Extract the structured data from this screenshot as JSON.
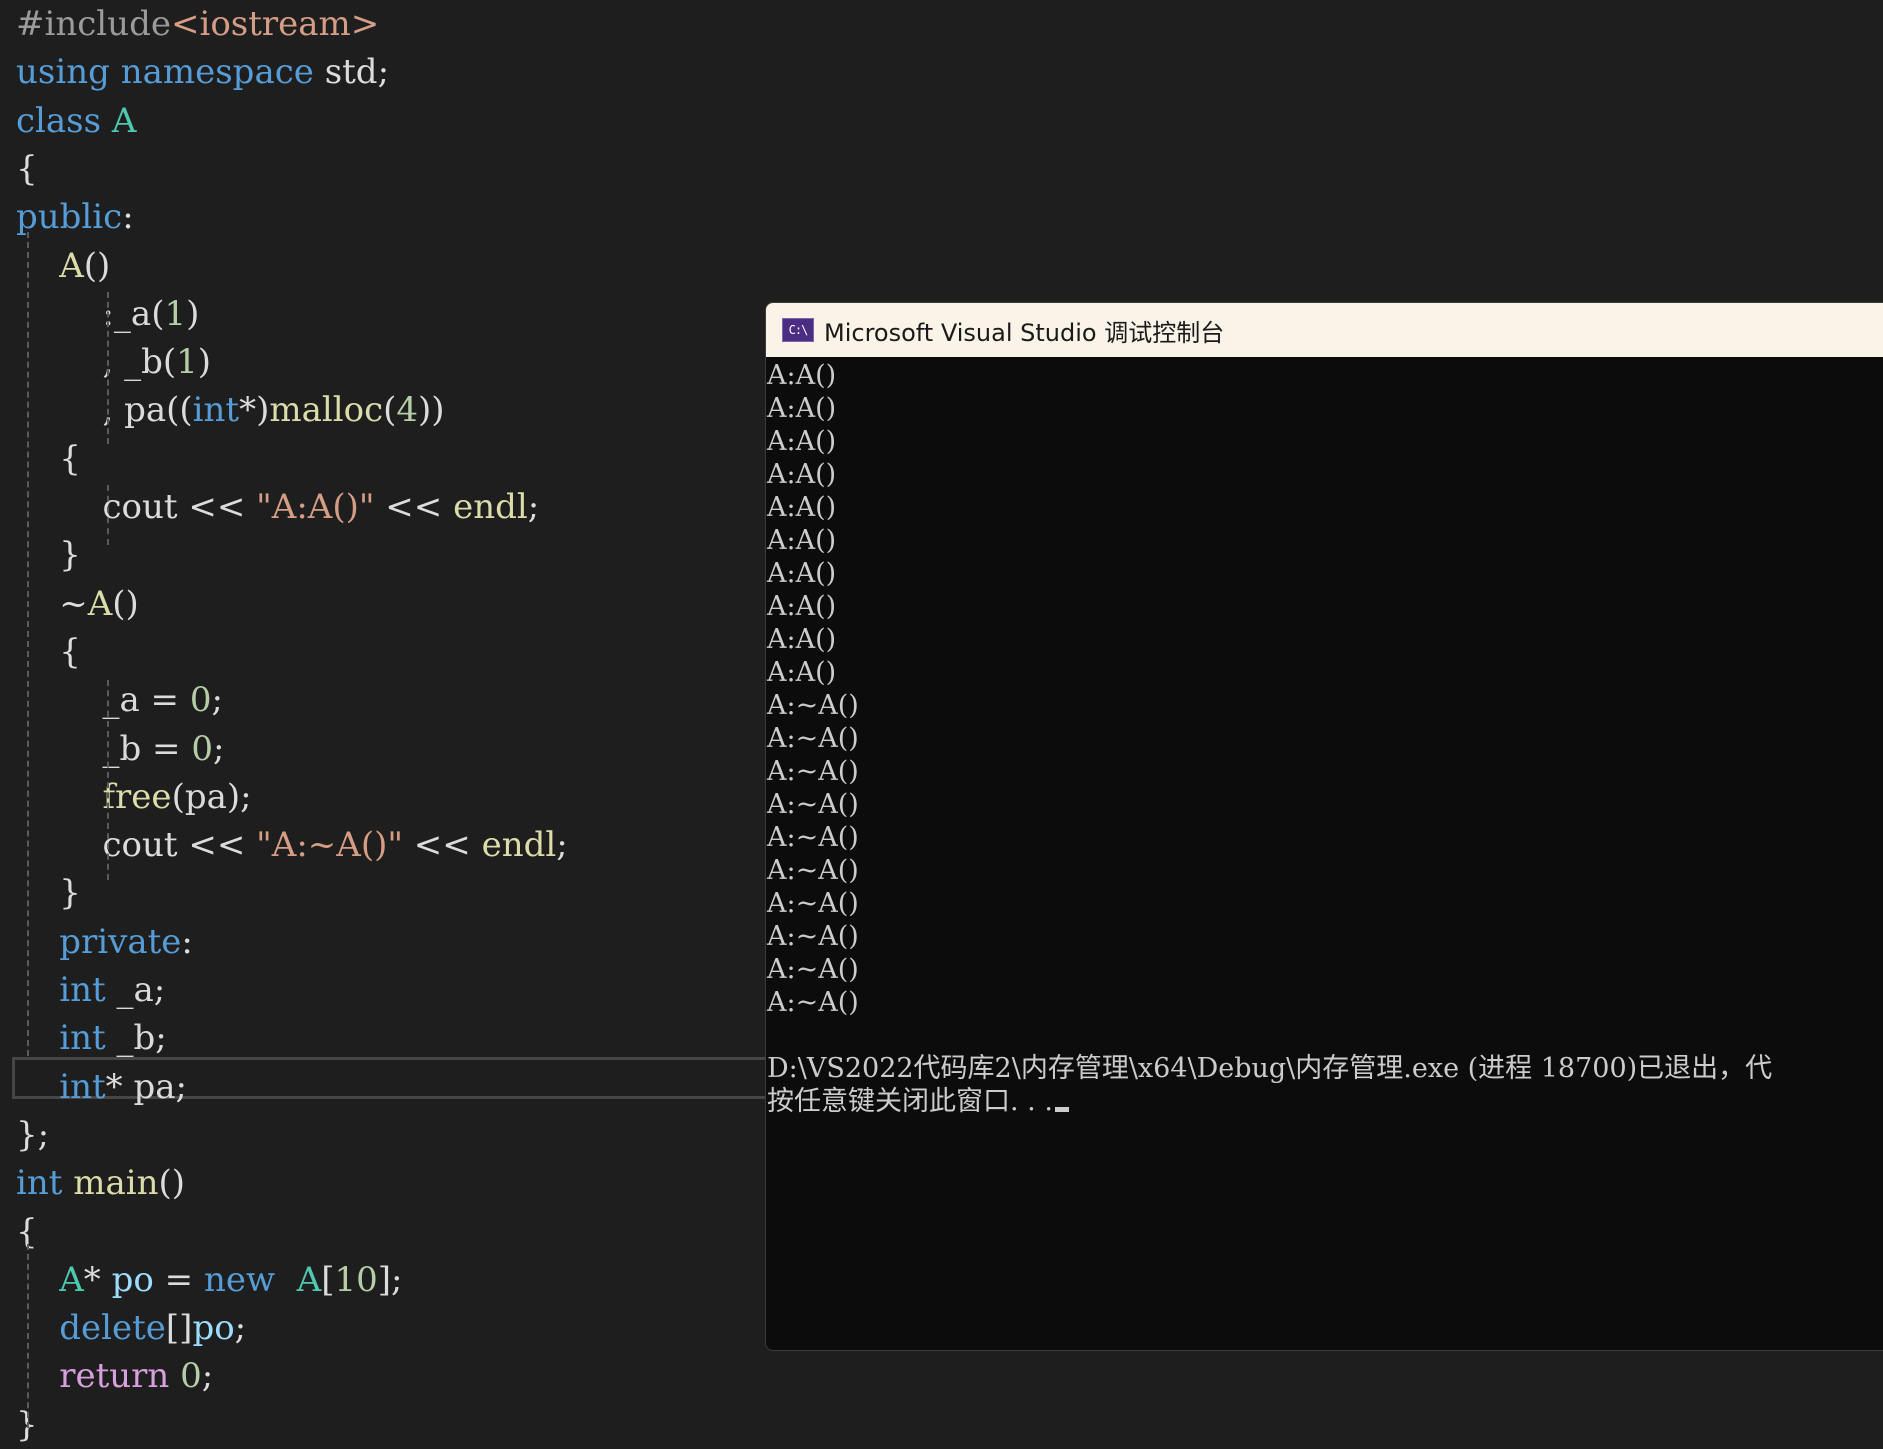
{
  "colors": {
    "editor_background": "#1e1e1e",
    "keyword": "#569cd6",
    "type_name": "#4ec9b0",
    "function": "#dcdcaa",
    "control_keyword": "#d8a0df",
    "preprocessor": "#9b9b9b",
    "string": "#d69d85",
    "number": "#b5cea8",
    "variable": "#9cdcfe",
    "field": "#dadada",
    "plain": "#dcdcdc",
    "console_background": "#0c0c0c",
    "console_text": "#cccccc",
    "console_titlebar": "#f9f3e8"
  },
  "code": [
    {
      "tokens": [
        {
          "text": "#include",
          "kind": "preprocessor"
        },
        {
          "text": "<iostream>",
          "kind": "string"
        }
      ]
    },
    {
      "tokens": [
        {
          "text": "using",
          "kind": "keyword"
        },
        {
          "text": " ",
          "kind": "plain"
        },
        {
          "text": "namespace",
          "kind": "keyword"
        },
        {
          "text": " std;",
          "kind": "plain"
        }
      ]
    },
    {
      "tokens": [
        {
          "text": "class",
          "kind": "keyword"
        },
        {
          "text": " ",
          "kind": "plain"
        },
        {
          "text": "A",
          "kind": "type_name"
        }
      ]
    },
    {
      "tokens": [
        {
          "text": "{",
          "kind": "plain"
        }
      ]
    },
    {
      "tokens": [
        {
          "text": "public",
          "kind": "keyword"
        },
        {
          "text": ":",
          "kind": "plain"
        }
      ]
    },
    {
      "tokens": [
        {
          "text": "    ",
          "kind": "plain"
        },
        {
          "text": "A",
          "kind": "function"
        },
        {
          "text": "()",
          "kind": "plain"
        }
      ]
    },
    {
      "tokens": [
        {
          "text": "        :",
          "kind": "plain"
        },
        {
          "text": "_a",
          "kind": "field"
        },
        {
          "text": "(",
          "kind": "plain"
        },
        {
          "text": "1",
          "kind": "number"
        },
        {
          "text": ")",
          "kind": "plain"
        }
      ]
    },
    {
      "tokens": [
        {
          "text": "        , ",
          "kind": "plain"
        },
        {
          "text": "_b",
          "kind": "field"
        },
        {
          "text": "(",
          "kind": "plain"
        },
        {
          "text": "1",
          "kind": "number"
        },
        {
          "text": ")",
          "kind": "plain"
        }
      ]
    },
    {
      "tokens": [
        {
          "text": "        , ",
          "kind": "plain"
        },
        {
          "text": "pa",
          "kind": "field"
        },
        {
          "text": "((",
          "kind": "plain"
        },
        {
          "text": "int",
          "kind": "keyword"
        },
        {
          "text": "*)",
          "kind": "plain"
        },
        {
          "text": "malloc",
          "kind": "function"
        },
        {
          "text": "(",
          "kind": "plain"
        },
        {
          "text": "4",
          "kind": "number"
        },
        {
          "text": "))",
          "kind": "plain"
        }
      ]
    },
    {
      "tokens": [
        {
          "text": "    {",
          "kind": "plain"
        }
      ]
    },
    {
      "tokens": [
        {
          "text": "        cout << ",
          "kind": "plain"
        },
        {
          "text": "\"A:A()\"",
          "kind": "string"
        },
        {
          "text": " << ",
          "kind": "plain"
        },
        {
          "text": "endl",
          "kind": "function"
        },
        {
          "text": ";",
          "kind": "plain"
        }
      ]
    },
    {
      "tokens": [
        {
          "text": "    }",
          "kind": "plain"
        }
      ]
    },
    {
      "tokens": [
        {
          "text": "    ~",
          "kind": "plain"
        },
        {
          "text": "A",
          "kind": "function"
        },
        {
          "text": "()",
          "kind": "plain"
        }
      ]
    },
    {
      "tokens": [
        {
          "text": "    {",
          "kind": "plain"
        }
      ]
    },
    {
      "tokens": [
        {
          "text": "        ",
          "kind": "plain"
        },
        {
          "text": "_a",
          "kind": "field"
        },
        {
          "text": " = ",
          "kind": "plain"
        },
        {
          "text": "0",
          "kind": "number"
        },
        {
          "text": ";",
          "kind": "plain"
        }
      ]
    },
    {
      "tokens": [
        {
          "text": "        ",
          "kind": "plain"
        },
        {
          "text": "_b",
          "kind": "field"
        },
        {
          "text": " = ",
          "kind": "plain"
        },
        {
          "text": "0",
          "kind": "number"
        },
        {
          "text": ";",
          "kind": "plain"
        }
      ]
    },
    {
      "tokens": [
        {
          "text": "        ",
          "kind": "plain"
        },
        {
          "text": "free",
          "kind": "function"
        },
        {
          "text": "(",
          "kind": "plain"
        },
        {
          "text": "pa",
          "kind": "field"
        },
        {
          "text": ");",
          "kind": "plain"
        }
      ]
    },
    {
      "tokens": [
        {
          "text": "        cout << ",
          "kind": "plain"
        },
        {
          "text": "\"A:~A()\"",
          "kind": "string"
        },
        {
          "text": " << ",
          "kind": "plain"
        },
        {
          "text": "endl",
          "kind": "function"
        },
        {
          "text": ";",
          "kind": "plain"
        }
      ]
    },
    {
      "tokens": [
        {
          "text": "    }",
          "kind": "plain"
        }
      ]
    },
    {
      "tokens": [
        {
          "text": "    ",
          "kind": "plain"
        },
        {
          "text": "private",
          "kind": "keyword"
        },
        {
          "text": ":",
          "kind": "plain"
        }
      ]
    },
    {
      "tokens": [
        {
          "text": "    ",
          "kind": "plain"
        },
        {
          "text": "int",
          "kind": "keyword"
        },
        {
          "text": " ",
          "kind": "plain"
        },
        {
          "text": "_a",
          "kind": "field"
        },
        {
          "text": ";",
          "kind": "plain"
        }
      ]
    },
    {
      "tokens": [
        {
          "text": "    ",
          "kind": "plain"
        },
        {
          "text": "int",
          "kind": "keyword"
        },
        {
          "text": " ",
          "kind": "plain"
        },
        {
          "text": "_b",
          "kind": "field"
        },
        {
          "text": ";",
          "kind": "plain"
        }
      ]
    },
    {
      "tokens": [
        {
          "text": "    ",
          "kind": "plain"
        },
        {
          "text": "int",
          "kind": "keyword"
        },
        {
          "text": "* ",
          "kind": "plain"
        },
        {
          "text": "pa",
          "kind": "field"
        },
        {
          "text": ";",
          "kind": "plain"
        }
      ]
    },
    {
      "tokens": [
        {
          "text": "};",
          "kind": "plain"
        }
      ]
    },
    {
      "tokens": [
        {
          "text": "int",
          "kind": "keyword"
        },
        {
          "text": " ",
          "kind": "plain"
        },
        {
          "text": "main",
          "kind": "function"
        },
        {
          "text": "()",
          "kind": "plain"
        }
      ]
    },
    {
      "tokens": [
        {
          "text": "{",
          "kind": "plain"
        }
      ]
    },
    {
      "tokens": [
        {
          "text": "    ",
          "kind": "plain"
        },
        {
          "text": "A",
          "kind": "type_name"
        },
        {
          "text": "* ",
          "kind": "plain"
        },
        {
          "text": "po",
          "kind": "variable"
        },
        {
          "text": " = ",
          "kind": "plain"
        },
        {
          "text": "new",
          "kind": "keyword"
        },
        {
          "text": "  ",
          "kind": "plain"
        },
        {
          "text": "A",
          "kind": "type_name"
        },
        {
          "text": "[",
          "kind": "plain"
        },
        {
          "text": "10",
          "kind": "number"
        },
        {
          "text": "];",
          "kind": "plain"
        }
      ]
    },
    {
      "tokens": [
        {
          "text": "    ",
          "kind": "plain"
        },
        {
          "text": "delete",
          "kind": "keyword"
        },
        {
          "text": "[]",
          "kind": "plain"
        },
        {
          "text": "po",
          "kind": "variable"
        },
        {
          "text": ";",
          "kind": "plain"
        }
      ]
    },
    {
      "tokens": [
        {
          "text": "    ",
          "kind": "plain"
        },
        {
          "text": "return",
          "kind": "control_keyword"
        },
        {
          "text": " ",
          "kind": "plain"
        },
        {
          "text": "0",
          "kind": "number"
        },
        {
          "text": ";",
          "kind": "plain"
        }
      ]
    },
    {
      "tokens": [
        {
          "text": "}",
          "kind": "plain"
        }
      ]
    }
  ],
  "console": {
    "icon": "console-app-icon",
    "icon_text": "C:\\",
    "title": "Microsoft Visual Studio 调试控制台",
    "output_lines": [
      "A:A()",
      "A:A()",
      "A:A()",
      "A:A()",
      "A:A()",
      "A:A()",
      "A:A()",
      "A:A()",
      "A:A()",
      "A:A()",
      "A:~A()",
      "A:~A()",
      "A:~A()",
      "A:~A()",
      "A:~A()",
      "A:~A()",
      "A:~A()",
      "A:~A()",
      "A:~A()",
      "A:~A()",
      "",
      "D:\\VS2022代码库2\\内存管理\\x64\\Debug\\内存管理.exe (进程 18700)已退出，代",
      "按任意键关闭此窗口. . ."
    ]
  }
}
